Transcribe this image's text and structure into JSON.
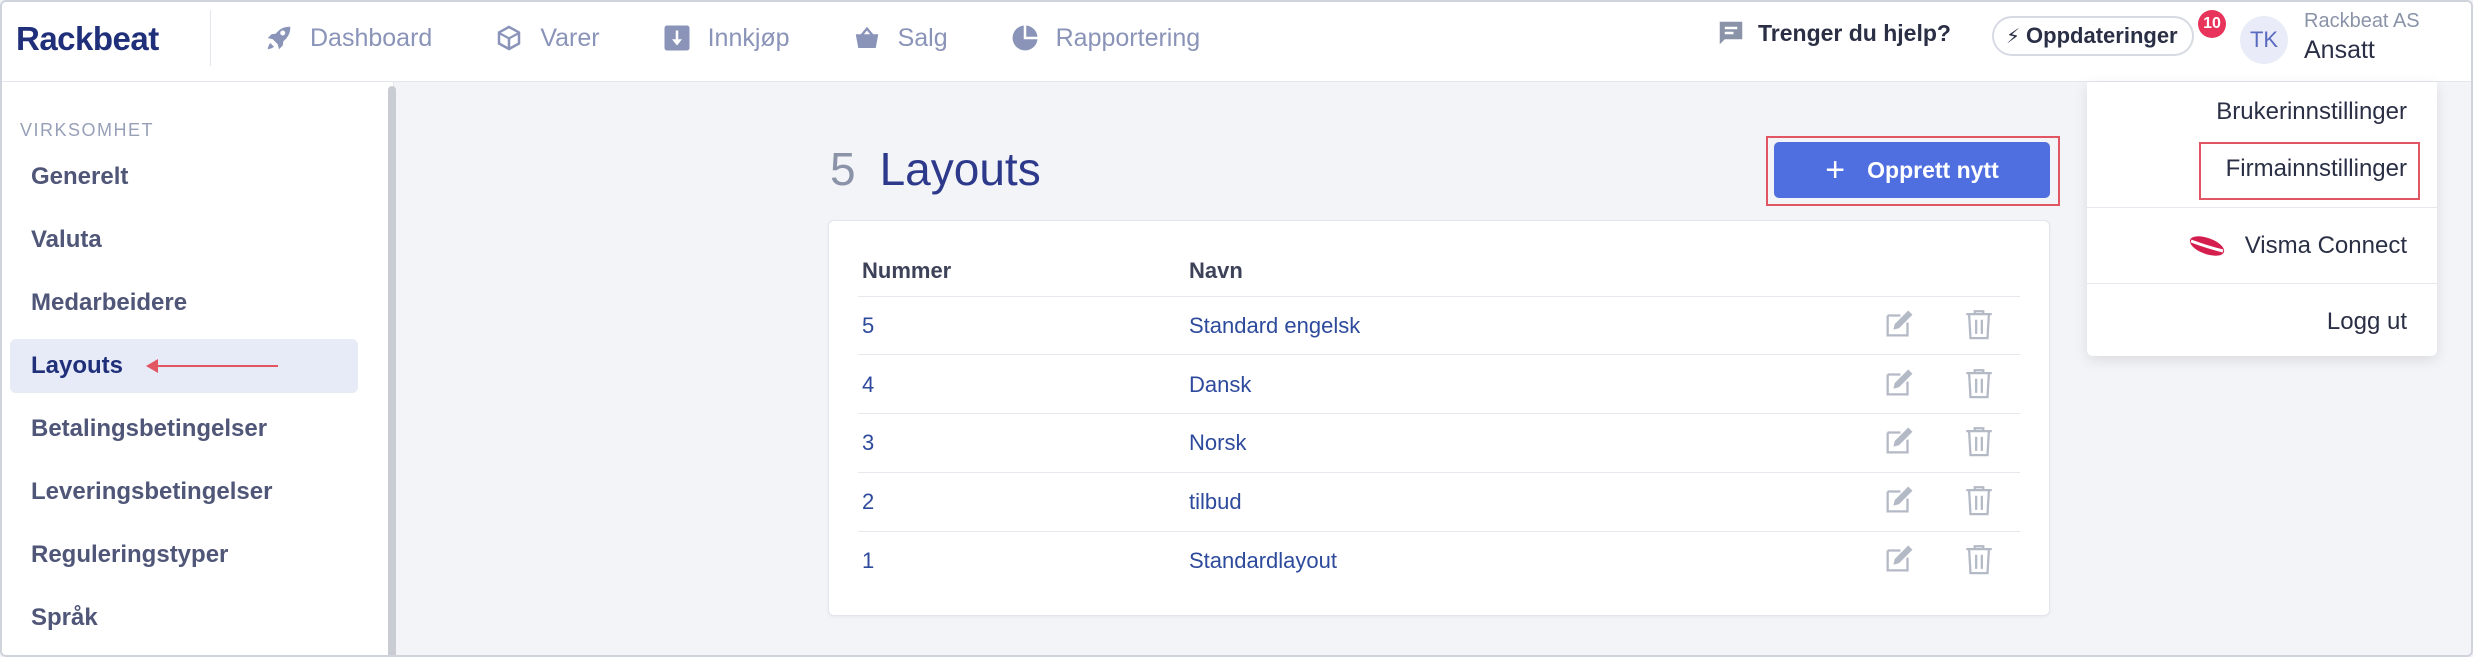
{
  "app": {
    "logo": "Rackbeat"
  },
  "nav": [
    {
      "label": "Dashboard",
      "icon": "rocket-icon"
    },
    {
      "label": "Varer",
      "icon": "box-icon"
    },
    {
      "label": "Innkjøp",
      "icon": "download-box-icon"
    },
    {
      "label": "Salg",
      "icon": "basket-icon"
    },
    {
      "label": "Rapportering",
      "icon": "pie-chart-icon"
    }
  ],
  "header": {
    "help_label": "Trenger du hjelp?",
    "updates_label": "Oppdateringer",
    "updates_badge": "10",
    "avatar_initials": "TK",
    "company": "Rackbeat AS",
    "role": "Ansatt"
  },
  "sidebar": {
    "section": "VIRKSOMHET",
    "items": [
      {
        "label": "Generelt"
      },
      {
        "label": "Valuta"
      },
      {
        "label": "Medarbeidere"
      },
      {
        "label": "Layouts"
      },
      {
        "label": "Betalingsbetingelser"
      },
      {
        "label": "Leveringsbetingelser"
      },
      {
        "label": "Reguleringstyper"
      },
      {
        "label": "Språk"
      }
    ],
    "active_index": 3
  },
  "main": {
    "count": "5",
    "title": "Layouts",
    "create_label": "Opprett nytt",
    "columns": [
      "Nummer",
      "Navn"
    ],
    "rows": [
      {
        "number": "5",
        "name": "Standard engelsk"
      },
      {
        "number": "4",
        "name": "Dansk"
      },
      {
        "number": "3",
        "name": "Norsk"
      },
      {
        "number": "2",
        "name": "tilbud"
      },
      {
        "number": "1",
        "name": "Standardlayout"
      }
    ]
  },
  "dropdown": {
    "items": [
      "Brukerinnstillinger",
      "Firmainnstillinger",
      "Visma Connect",
      "Logg ut"
    ]
  },
  "colors": {
    "accent": "#4f6ee0",
    "highlight": "#e25563",
    "brand": "#1f2f7a"
  }
}
